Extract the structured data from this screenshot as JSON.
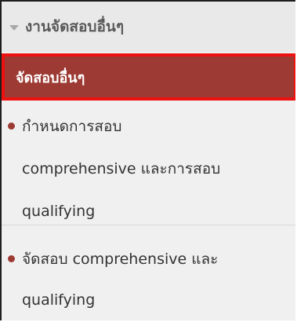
{
  "menu": {
    "header_label": "งานจัดสอบอื่นๆ",
    "active_item_label": "จัดสอบอื่นๆ",
    "items": [
      {
        "line1": "กำหนดการสอบ",
        "line2": "comprehensive และการสอบ",
        "line3": "qualifying"
      },
      {
        "line1": "จัดสอบ comprehensive และ",
        "line2": "qualifying"
      }
    ]
  },
  "colors": {
    "accent": "#9c3a33",
    "highlight_border": "#ee1111",
    "header_bg": "#e9e9e9",
    "list_bg": "#f0f0f0"
  },
  "icons": {
    "header_caret": "caret-down-icon",
    "item_bullet": "bullet-icon"
  }
}
